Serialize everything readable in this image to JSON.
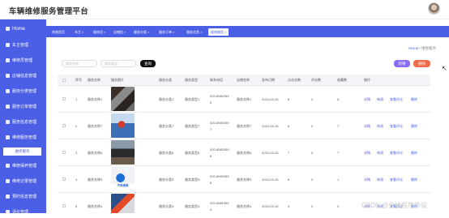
{
  "app": {
    "title": "车辆维修服务管理平台"
  },
  "sidebar": {
    "home": "Home",
    "items": [
      "车主管理",
      "维修员管理",
      "店铺信息管理",
      "服务分类管理",
      "服务订单管理",
      "服务信息管理",
      "维修服务管理",
      "维修保养管理",
      "维修记录管理",
      "预约信息管理",
      "评价管理"
    ],
    "active_sub": "维修服务"
  },
  "tabs": [
    {
      "label": "系统首页",
      "active": false
    },
    {
      "label": "车主 ×",
      "active": false
    },
    {
      "label": "维修员 ×",
      "active": false
    },
    {
      "label": "店铺信 ×",
      "active": false
    },
    {
      "label": "服务分类 ×",
      "active": false
    },
    {
      "label": "服务订单 ×",
      "active": false
    },
    {
      "label": "服务信息 ×",
      "active": false
    },
    {
      "label": "维修服务 ×",
      "active": true
    }
  ],
  "breadcrumb": {
    "home": "Home",
    "sep": "/",
    "current": "维修服务"
  },
  "search": {
    "placeholder1": "服务名称",
    "placeholder2": "服务类型",
    "button": "查询"
  },
  "actions": {
    "add": "新增",
    "delete": "删除"
  },
  "table": {
    "headers": [
      "序号",
      "服务名称",
      "服务图片",
      "服务分类",
      "服务类型",
      "联系电话",
      "店铺名称",
      "发布日期",
      "点击次数",
      "评论数",
      "收藏数",
      "操作"
    ],
    "row_actions": [
      "详情",
      "修改",
      "查看评论",
      "删除"
    ],
    "rows": [
      {
        "no": "1",
        "name": "服务名称1",
        "cat": "服务分类1",
        "type": "服务类型1",
        "phone": "020-8981959",
        "phone2": "5",
        "shop": "服务名称1",
        "date": "2024-03-15",
        "clicks": "8",
        "comments": "0",
        "favs": "6"
      },
      {
        "no": "2",
        "name": "服务名称7",
        "cat": "服务分类7",
        "type": "服务类型7",
        "phone": "020-8981959",
        "phone2": "7",
        "shop": "服务名称7",
        "date": "2024-03-15",
        "clicks": "8",
        "comments": "0",
        "favs": "7"
      },
      {
        "no": "3",
        "name": "服务名称6",
        "cat": "服务分类6",
        "type": "服务类型6",
        "phone": "020-8981959",
        "phone2": "6",
        "shop": "服务名称6",
        "date": "2024-03-15",
        "clicks": "7",
        "comments": "0",
        "favs": "7"
      },
      {
        "no": "4",
        "name": "服务名称5",
        "cat": "服务分类5",
        "type": "服务类型5",
        "phone": "020-8981959",
        "phone2": "5",
        "shop": "服务名称5",
        "date": "2024-03-15",
        "clicks": "8",
        "comments": "0",
        "favs": "1"
      },
      {
        "no": "5",
        "name": "服务名称4",
        "cat": "服务分类4",
        "type": "服务类型4",
        "phone": "020-8981959",
        "phone2": "4",
        "shop": "服务名称4",
        "date": "2024-03-15",
        "clicks": "4",
        "comments": "0",
        "favs": "4"
      }
    ]
  },
  "thumb_text": "汽车维修",
  "watermark": "CSDN @全栈程序华设",
  "colors": {
    "primary": "#4a5ee6",
    "add": "#8a6cf6",
    "delete": "#f06b4a"
  }
}
